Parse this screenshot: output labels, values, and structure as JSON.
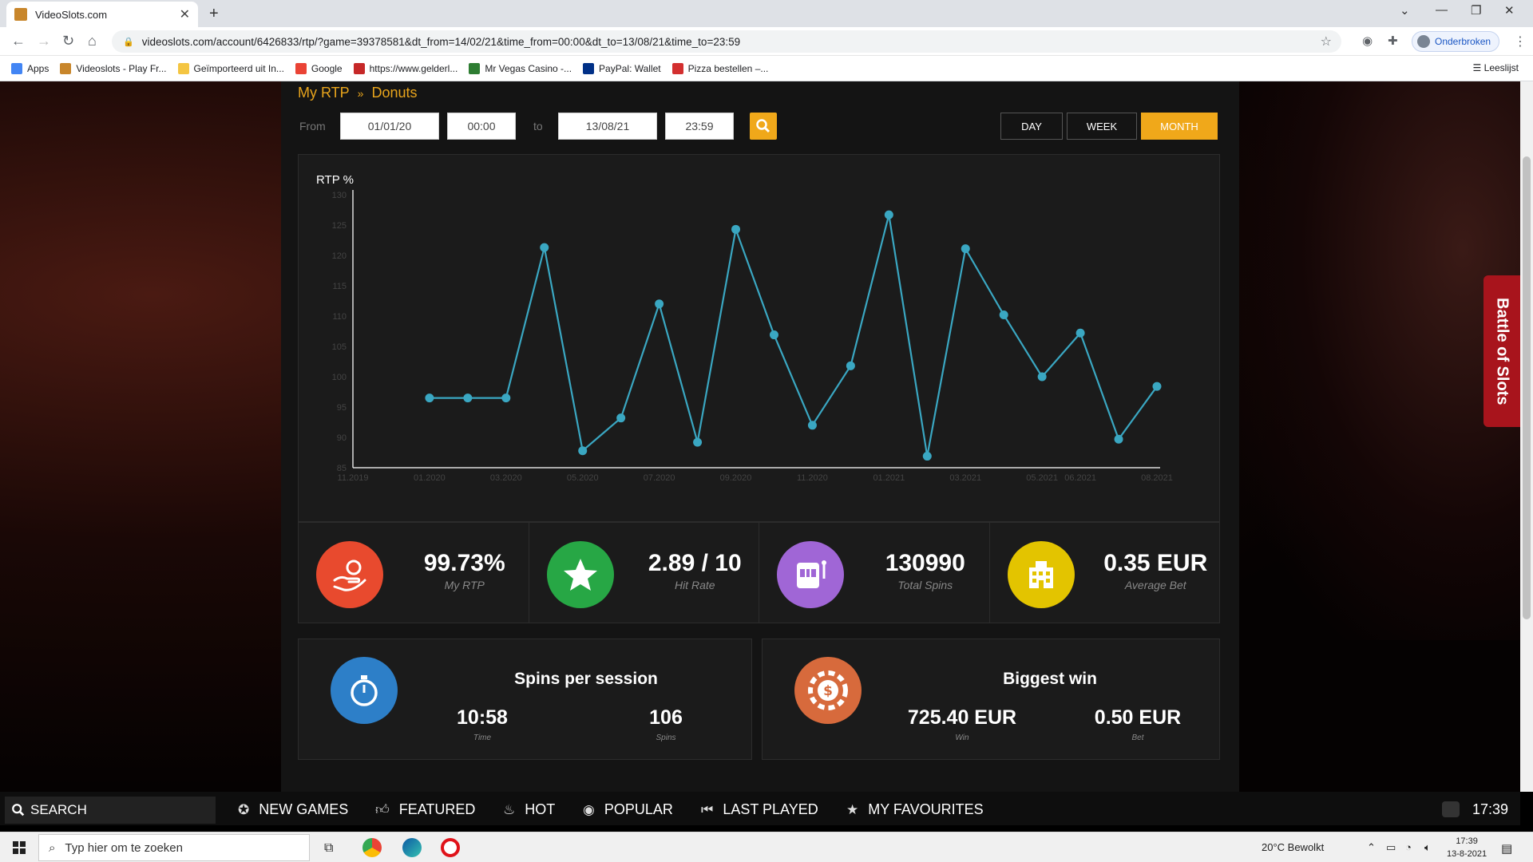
{
  "browser": {
    "tab_title": "VideoSlots.com",
    "new_tab": "+",
    "url": "videoslots.com/account/6426833/rtp/?game=39378581&dt_from=14/02/21&time_from=00:00&dt_to=13/08/21&time_to=23:59",
    "profile_label": "Onderbroken",
    "reading_list": "Leeslijst",
    "bookmarks": [
      {
        "label": "Apps",
        "color": "#4285f4"
      },
      {
        "label": "Videoslots - Play Fr...",
        "color": "#c8862b"
      },
      {
        "label": "Geïmporteerd uit In...",
        "color": "#f4c542"
      },
      {
        "label": "Google",
        "color": "#ea4335"
      },
      {
        "label": "https://www.gelderl...",
        "color": "#c62828"
      },
      {
        "label": "Mr Vegas Casino -...",
        "color": "#2e7d32"
      },
      {
        "label": "PayPal: Wallet",
        "color": "#003087"
      },
      {
        "label": "Pizza bestellen –...",
        "color": "#d32f2f"
      }
    ]
  },
  "breadcrumb": {
    "root": "My RTP",
    "sep": "»",
    "current": "Donuts"
  },
  "filter": {
    "from_label": "From",
    "from_date": "01/01/20",
    "from_time": "00:00",
    "to_label": "to",
    "to_date": "13/08/21",
    "to_time": "23:59",
    "periods": [
      "DAY",
      "WEEK",
      "MONTH"
    ],
    "active_period": "MONTH"
  },
  "chart_data": {
    "type": "line",
    "ylabel": "RTP %",
    "ylim": [
      85,
      130
    ],
    "yticks": [
      85,
      90,
      95,
      100,
      105,
      110,
      115,
      120,
      125,
      130
    ],
    "xlim": [
      "2019-11",
      "2021-08"
    ],
    "xticks": [
      "11.2019",
      "01.2020",
      "03.2020",
      "05.2020",
      "07.2020",
      "09.2020",
      "11.2020",
      "01.2021",
      "03.2021",
      "05.2021",
      "06.2021",
      "08.2021"
    ],
    "color": "#3aa7c2",
    "points": [
      {
        "x": "2020-01",
        "y": 96.5
      },
      {
        "x": "2020-02",
        "y": 96.5
      },
      {
        "x": "2020-03",
        "y": 96.5
      },
      {
        "x": "2020-04",
        "y": 121.3
      },
      {
        "x": "2020-05",
        "y": 87.8
      },
      {
        "x": "2020-06",
        "y": 93.2
      },
      {
        "x": "2020-07",
        "y": 112.0
      },
      {
        "x": "2020-08",
        "y": 89.2
      },
      {
        "x": "2020-09",
        "y": 124.3
      },
      {
        "x": "2020-10",
        "y": 106.9
      },
      {
        "x": "2020-11",
        "y": 92.0
      },
      {
        "x": "2020-12",
        "y": 101.8
      },
      {
        "x": "2021-01",
        "y": 126.7
      },
      {
        "x": "2021-02",
        "y": 86.9
      },
      {
        "x": "2021-03",
        "y": 121.1
      },
      {
        "x": "2021-04",
        "y": 110.2
      },
      {
        "x": "2021-05",
        "y": 100.0
      },
      {
        "x": "2021-06",
        "y": 107.2
      },
      {
        "x": "2021-07",
        "y": 89.7
      },
      {
        "x": "2021-08",
        "y": 98.4
      }
    ]
  },
  "stats": [
    {
      "value": "99.73%",
      "label": "My RTP",
      "color": "#e84a2e",
      "icon": "hand-coin-icon"
    },
    {
      "value": "2.89 / 10",
      "label": "Hit Rate",
      "color": "#27a745",
      "icon": "star-icon"
    },
    {
      "value": "130990",
      "label": "Total Spins",
      "color": "#a066d6",
      "icon": "slot-machine-icon"
    },
    {
      "value": "0.35 EUR",
      "label": "Average Bet",
      "color": "#e3c400",
      "icon": "building-icon"
    }
  ],
  "sessions": {
    "title": "Spins per session",
    "time_value": "10:58",
    "time_label": "Time",
    "spins_value": "106",
    "spins_label": "Spins",
    "color": "#2d7fc8"
  },
  "biggest_win": {
    "title": "Biggest win",
    "win_value": "725.40 EUR",
    "win_label": "Win",
    "bet_value": "0.50 EUR",
    "bet_label": "Bet",
    "color": "#d76a3c"
  },
  "side_tab": "Battle of Slots",
  "site_nav": {
    "search": "SEARCH",
    "items": [
      "NEW GAMES",
      "FEATURED",
      "HOT",
      "POPULAR",
      "LAST PLAYED",
      "MY FAVOURITES"
    ],
    "clock": "17:39"
  },
  "taskbar": {
    "search_placeholder": "Typ hier om te zoeken",
    "weather": "20°C  Bewolkt",
    "time": "17:39",
    "date": "13-8-2021"
  }
}
